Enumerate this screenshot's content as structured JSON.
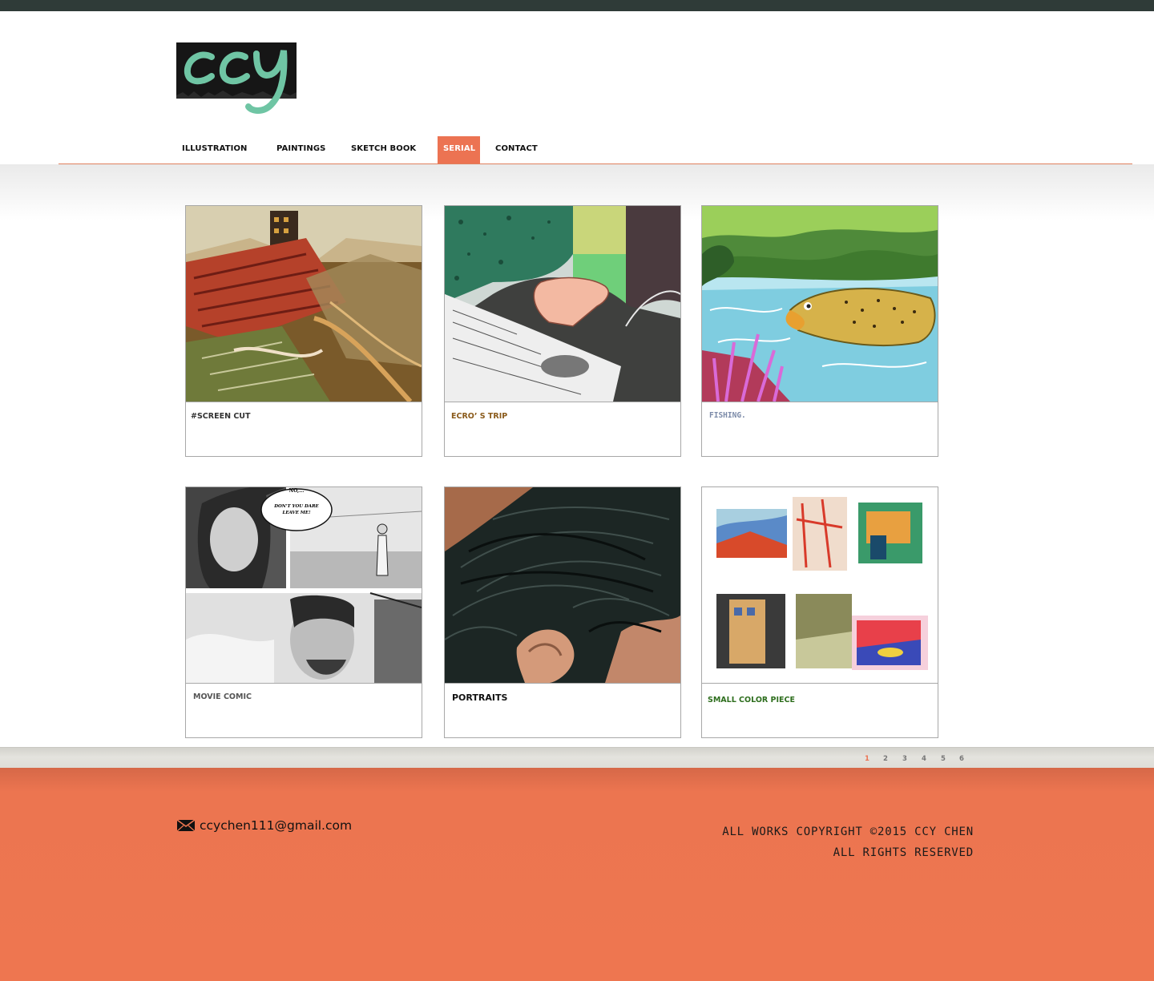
{
  "logo": {
    "text": "ccy"
  },
  "nav": {
    "items": [
      {
        "label": "ILLUSTRATION",
        "active": false
      },
      {
        "label": "PAINTINGS",
        "active": false
      },
      {
        "label": "SKETCH BOOK",
        "active": false
      },
      {
        "label": "SERIAL",
        "active": true
      },
      {
        "label": "CONTACT",
        "active": false
      }
    ]
  },
  "accent_color": "#ec7352",
  "cards": [
    {
      "title": "#SCREEN CUT",
      "title_color": "#333333"
    },
    {
      "title": "ECRO’ S TRIP",
      "title_color": "#8a5a1a"
    },
    {
      "title": "FISHING.",
      "title_color": "#7b8aa8"
    },
    {
      "title": "MOVIE COMIC",
      "title_color": "#555555"
    },
    {
      "title": "PORTRAITS",
      "title_color": "#111111"
    },
    {
      "title": "SMALL COLOR PIECE",
      "title_color": "#2e6e1e"
    }
  ],
  "comic_bubble": {
    "line1": "NO,...",
    "line2": "DON'T YOU DARE",
    "line3": "LEAVE ME!"
  },
  "pagination": {
    "pages": [
      "1",
      "2",
      "3",
      "4",
      "5",
      "6"
    ],
    "current": "1"
  },
  "footer": {
    "email": "ccychen111@gmail.com",
    "copyright_line1": "ALL WORKS COPYRIGHT ©2015 CCY CHEN",
    "copyright_line2": "ALL RIGHTS RESERVED",
    "background_color": "#ee7650"
  }
}
